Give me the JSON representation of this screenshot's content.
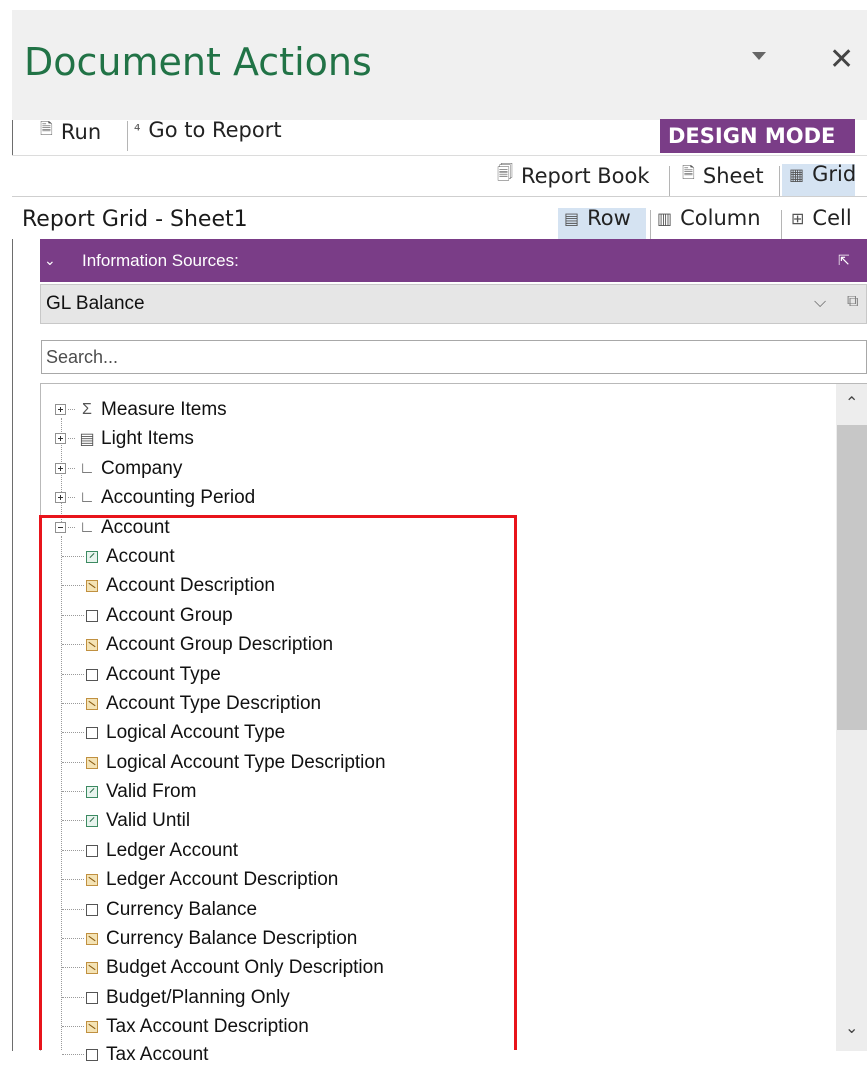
{
  "pane": {
    "title": "Document Actions",
    "close_glyph": "✕"
  },
  "toolbar": {
    "run_label": "Run",
    "go_to_report_label": "Go to Report",
    "design_mode_label": "DESIGN MODE",
    "report_book_label": "Report Book",
    "sheet_label": "Sheet",
    "grid_label": "Grid",
    "row_label": "Row",
    "column_label": "Column",
    "cell_label": "Cell",
    "selected_scope": "Grid",
    "selected_axis": "Row"
  },
  "report_grid": {
    "title": "Report Grid - Sheet1"
  },
  "info_sources": {
    "label": "Information Sources:",
    "selected_source": "GL Balance"
  },
  "search": {
    "placeholder": "Search..."
  },
  "tree": {
    "groups": [
      {
        "label": "Measure Items",
        "icon": "sigma-icon",
        "expanded": false
      },
      {
        "label": "Light Items",
        "icon": "list-icon",
        "expanded": false
      },
      {
        "label": "Company",
        "icon": "dimension-icon",
        "expanded": false
      },
      {
        "label": "Accounting Period",
        "icon": "dimension-icon",
        "expanded": false
      },
      {
        "label": "Account",
        "icon": "dimension-icon",
        "expanded": true
      }
    ],
    "account_children": [
      {
        "label": "Account",
        "type": "date"
      },
      {
        "label": "Account Description",
        "type": "desc"
      },
      {
        "label": "Account Group",
        "type": "plain"
      },
      {
        "label": "Account Group Description",
        "type": "desc"
      },
      {
        "label": "Account Type",
        "type": "plain"
      },
      {
        "label": "Account Type Description",
        "type": "desc"
      },
      {
        "label": "Logical Account Type",
        "type": "plain"
      },
      {
        "label": "Logical Account Type Description",
        "type": "desc"
      },
      {
        "label": "Valid From",
        "type": "date"
      },
      {
        "label": "Valid Until",
        "type": "date"
      },
      {
        "label": "Ledger Account",
        "type": "plain"
      },
      {
        "label": "Ledger Account Description",
        "type": "desc"
      },
      {
        "label": "Currency Balance",
        "type": "plain"
      },
      {
        "label": "Currency Balance Description",
        "type": "desc"
      },
      {
        "label": "Budget Account Only Description",
        "type": "desc"
      },
      {
        "label": "Budget/Planning Only",
        "type": "plain"
      },
      {
        "label": "Tax Account Description",
        "type": "desc"
      },
      {
        "label": "Tax Account",
        "type": "plain"
      }
    ]
  },
  "colors": {
    "title_green": "#217346",
    "accent_purple": "#7a3d87",
    "highlight_red": "#e8141b",
    "selected_blue": "#d5e3f2"
  }
}
